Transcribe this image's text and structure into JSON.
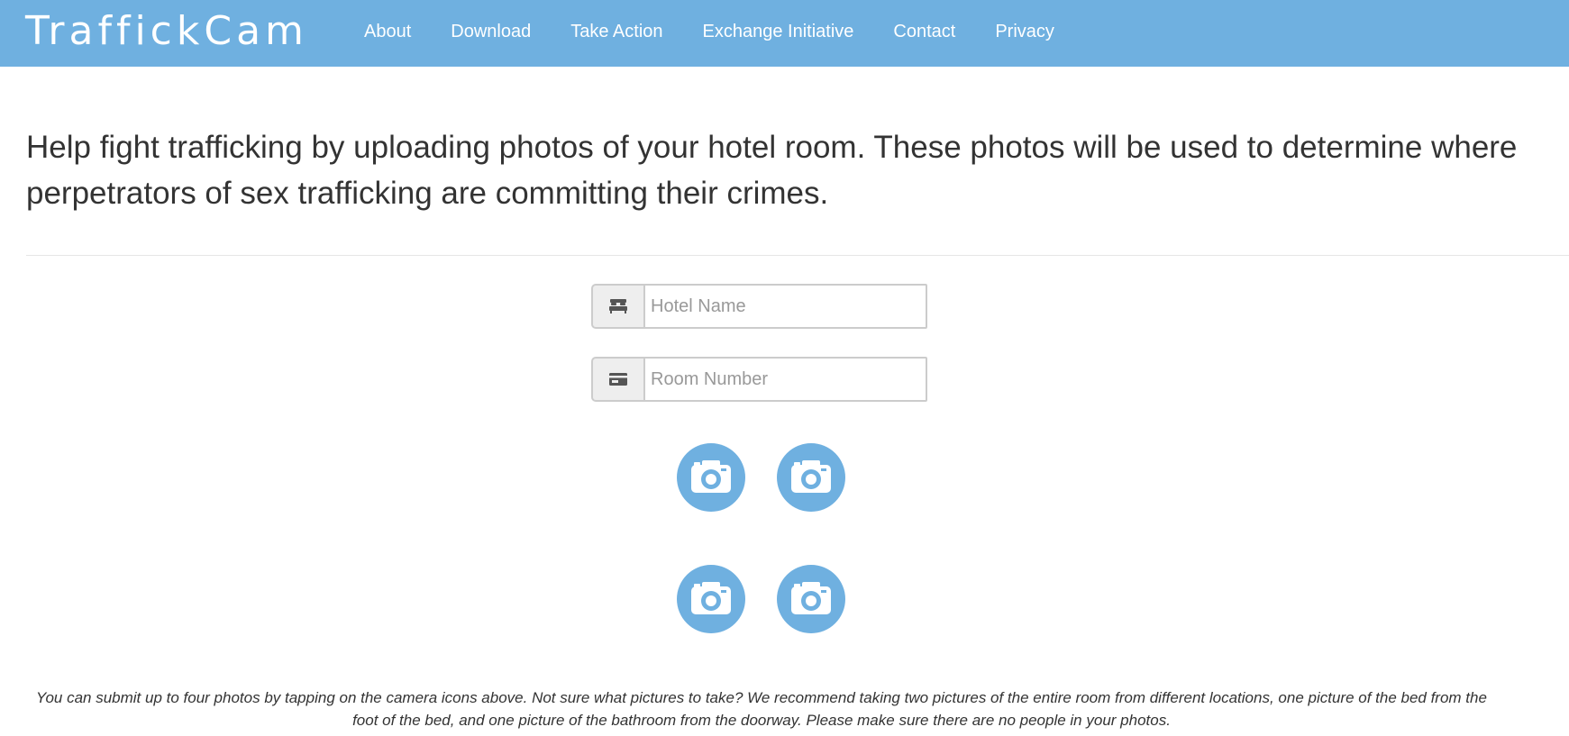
{
  "brand": {
    "logo_text": "TraffickCam",
    "navbar_color": "#6fb0e0"
  },
  "nav": {
    "items": [
      {
        "label": "About"
      },
      {
        "label": "Download"
      },
      {
        "label": "Take Action"
      },
      {
        "label": "Exchange Initiative"
      },
      {
        "label": "Contact"
      },
      {
        "label": "Privacy"
      }
    ]
  },
  "intro": {
    "text": "Help fight trafficking by uploading photos of your hotel room. These photos will be used to determine where perpetrators of sex trafficking are committing their crimes."
  },
  "form": {
    "hotel": {
      "placeholder": "Hotel Name",
      "value": "",
      "icon": "bed-icon"
    },
    "room": {
      "placeholder": "Room Number",
      "value": "",
      "icon": "room-card-icon"
    }
  },
  "photos": {
    "slots": [
      {
        "icon": "camera-icon"
      },
      {
        "icon": "camera-icon"
      },
      {
        "icon": "camera-icon"
      },
      {
        "icon": "camera-icon"
      }
    ],
    "accent": "#6fb0e0"
  },
  "instructions": {
    "text": "You can submit up to four photos by tapping on the camera icons above. Not sure what pictures to take? We recommend taking two pictures of the entire room from different locations, one picture of the bed from the foot of the bed, and one picture of the bathroom from the doorway. Please make sure there are no people in your photos."
  }
}
